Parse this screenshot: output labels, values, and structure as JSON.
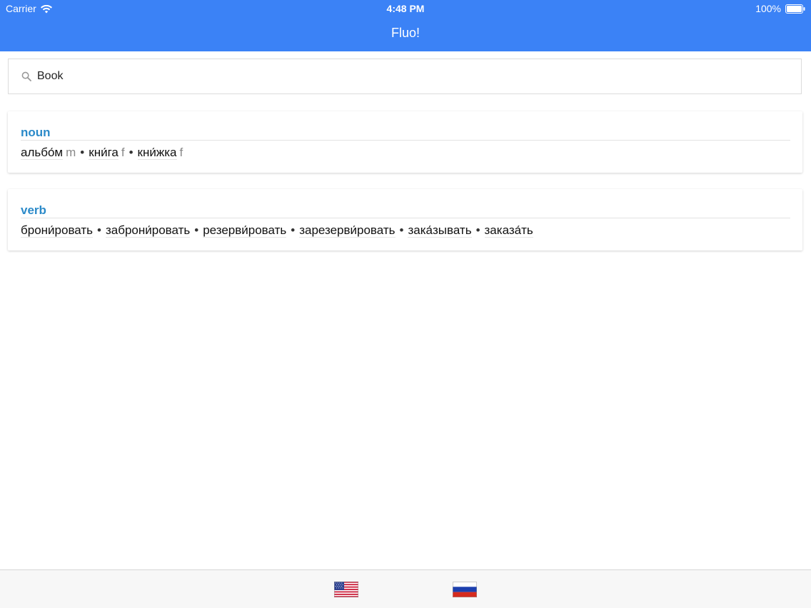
{
  "status_bar": {
    "carrier": "Carrier",
    "time": "4:48 PM",
    "battery": "100%"
  },
  "nav": {
    "title": "Fluo!"
  },
  "search": {
    "value": "Book",
    "icon": "search-icon"
  },
  "results": [
    {
      "pos": "noun",
      "translations": [
        {
          "word": "альбо́м",
          "gender": "m"
        },
        {
          "word": "кни́га",
          "gender": "f"
        },
        {
          "word": "кни́жка",
          "gender": "f"
        }
      ]
    },
    {
      "pos": "verb",
      "translations": [
        {
          "word": "брони́ровать"
        },
        {
          "word": "заброни́ровать"
        },
        {
          "word": "резерви́ровать"
        },
        {
          "word": "зарезерви́ровать"
        },
        {
          "word": "зака́зывать"
        },
        {
          "word": "заказа́ть"
        }
      ]
    }
  ],
  "separator": "•",
  "bottom_bar": {
    "flags": [
      {
        "name": "us-flag-icon"
      },
      {
        "name": "russia-flag-icon"
      }
    ]
  },
  "colors": {
    "header": "#3b82f6",
    "pos_label": "#2b8ac9"
  }
}
